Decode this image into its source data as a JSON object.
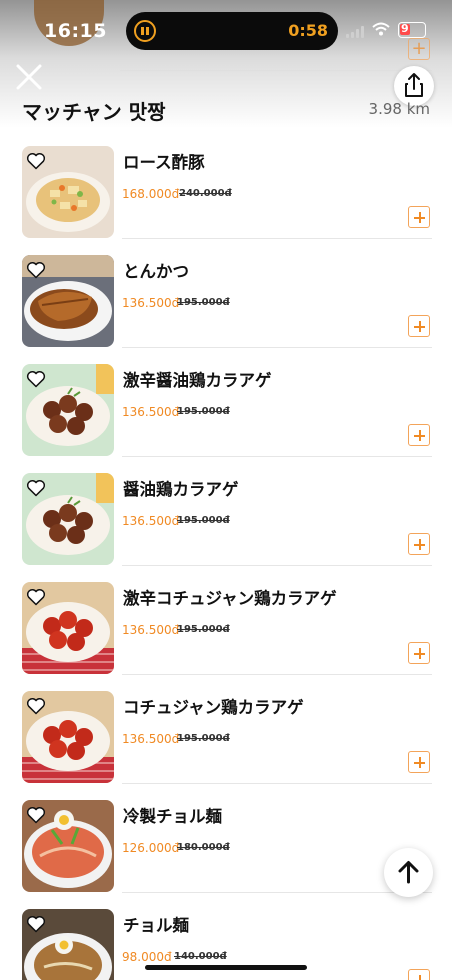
{
  "status_bar": {
    "time": "16:15",
    "timer": "0:58",
    "battery": "9"
  },
  "header": {
    "store_name": "マッチャン 맛짱",
    "distance": "3.98 km"
  },
  "colors": {
    "accent": "#f08a24",
    "text": "#111111",
    "divider": "#e6e6e6"
  },
  "menu_items": [
    {
      "name": "ロース酢豚",
      "price": "168.000đ",
      "old_price": "240.000đ",
      "dish": "sweet-sour-pork"
    },
    {
      "name": "とんかつ",
      "price": "136.500đ",
      "old_price": "195.000đ",
      "dish": "tonkatsu-curry"
    },
    {
      "name": "激辛醤油鶏カラアゲ",
      "price": "136.500đ",
      "old_price": "195.000đ",
      "dish": "soy-karaage"
    },
    {
      "name": "醤油鶏カラアゲ",
      "price": "136.500đ",
      "old_price": "195.000đ",
      "dish": "soy-karaage"
    },
    {
      "name": "激辛コチュジャン鶏カラアゲ",
      "price": "136.500đ",
      "old_price": "195.000đ",
      "dish": "gochujang-karaage"
    },
    {
      "name": "コチュジャン鶏カラアゲ",
      "price": "136.500đ",
      "old_price": "195.000đ",
      "dish": "gochujang-karaage"
    },
    {
      "name": "冷製チョル麺",
      "price": "126.000đ",
      "old_price": "180.000đ",
      "dish": "cold-noodles"
    },
    {
      "name": "チョル麺",
      "price": "98.000đ",
      "old_price": "140.000đ",
      "dish": "noodle-bowl"
    }
  ],
  "icons": {
    "close": "close-icon",
    "share": "share-icon",
    "favorite": "heart-outline-icon",
    "add": "plus-icon",
    "scroll_top": "arrow-up-icon"
  }
}
